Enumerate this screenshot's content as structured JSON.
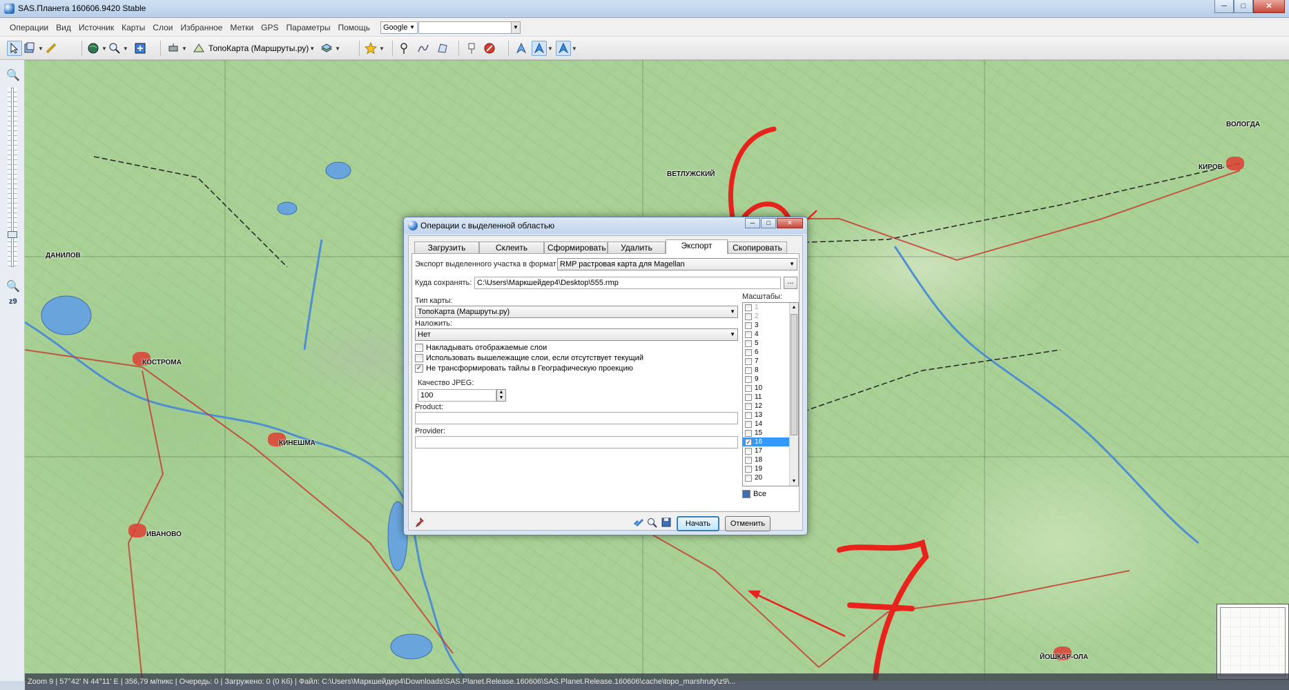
{
  "window": {
    "title": "SAS.Планета 160606.9420 Stable",
    "min_label": "─",
    "max_label": "□",
    "close_label": "✕"
  },
  "menu": {
    "items": [
      "Операции",
      "Вид",
      "Источник",
      "Карты",
      "Слои",
      "Избранное",
      "Метки",
      "GPS",
      "Параметры",
      "Помощь"
    ],
    "search_provider": "Google",
    "search_value": ""
  },
  "toolbar": {
    "map_selector": "ТопоКарта (Маршруты.ру)",
    "icons": [
      "cursor-icon",
      "layers-icon",
      "ruler-icon",
      "globe-icon",
      "search-icon",
      "fullscreen-icon",
      "satellite-icon",
      "stack-icon",
      "star-icon",
      "placemark-icon",
      "path-icon",
      "polygon-icon",
      "pushpin-icon",
      "stop-icon",
      "gps-icon",
      "gps-track-icon",
      "gps-follow-icon"
    ]
  },
  "zoom": {
    "level_label": "z9"
  },
  "map": {
    "cities": [
      "КОСТРОМА",
      "КИНЕШМА",
      "ИВАНОВО",
      "КИРОВ",
      "ЙОШКАР-ОЛА",
      "ВОЛОГДА",
      "ДАНИЛОВ",
      "ВЕТЛУЖСКИЙ"
    ],
    "annotation_1": "6",
    "annotation_2": "7",
    "annotation_color": "#e8231c"
  },
  "statusbar": {
    "text": "Zoom 9 | 57°42' N 44°11' E | 356,79 м/пикс | Очередь: 0 | Загружено: 0 (0 Кб) | Файл: C:\\Users\\Маркшейдер4\\Downloads\\SAS.Planet.Release.160606\\SAS.Planet.Release.160606\\cache\\topo_marshruty\\z9\\..."
  },
  "dialog": {
    "title": "Операции с выделенной областью",
    "tabs": [
      "Загрузить",
      "Склеить",
      "Сформировать",
      "Удалить",
      "Экспорт",
      "Скопировать"
    ],
    "active_tab": "Экспорт",
    "format_label": "Экспорт выделенного участка в формат",
    "format_value": "RMP растровая карта для Magellan",
    "save_label": "Куда сохранять:",
    "save_path": "C:\\Users\\Маркшейдер4\\Desktop\\555.rmp",
    "browse_label": "...",
    "map_type_label": "Тип карты:",
    "map_type_value": "ТопоКарта (Маршруты.ру)",
    "overlay_label": "Наложить:",
    "overlay_value": "Нет",
    "checkboxes": [
      {
        "label": "Накладывать отображаемые слои",
        "checked": false
      },
      {
        "label": "Использовать вышележащие слои, если отсутствует текущий",
        "checked": false
      },
      {
        "label": "Не трансформировать тайлы в Географическую проекцию",
        "checked": true
      }
    ],
    "jpeg_quality_label": "Качество JPEG:",
    "jpeg_quality_value": "100",
    "product_label": "Product:",
    "product_value": "",
    "provider_label": "Provider:",
    "provider_value": "",
    "scales_label": "Масштабы:",
    "scales": [
      {
        "label": "1",
        "checked": false,
        "disabled": true
      },
      {
        "label": "2",
        "checked": false,
        "disabled": true
      },
      {
        "label": "3",
        "checked": false
      },
      {
        "label": "4",
        "checked": false
      },
      {
        "label": "5",
        "checked": false
      },
      {
        "label": "6",
        "checked": false
      },
      {
        "label": "7",
        "checked": false
      },
      {
        "label": "8",
        "checked": false
      },
      {
        "label": "9",
        "checked": false
      },
      {
        "label": "10",
        "checked": false
      },
      {
        "label": "11",
        "checked": false
      },
      {
        "label": "12",
        "checked": false
      },
      {
        "label": "13",
        "checked": false
      },
      {
        "label": "14",
        "checked": false
      },
      {
        "label": "15",
        "checked": false
      },
      {
        "label": "16",
        "checked": true,
        "selected": true
      },
      {
        "label": "17",
        "checked": false
      },
      {
        "label": "18",
        "checked": false
      },
      {
        "label": "19",
        "checked": false
      },
      {
        "label": "20",
        "checked": false
      }
    ],
    "all_label": "Все",
    "start_label": "Начать",
    "cancel_label": "Отменить"
  }
}
